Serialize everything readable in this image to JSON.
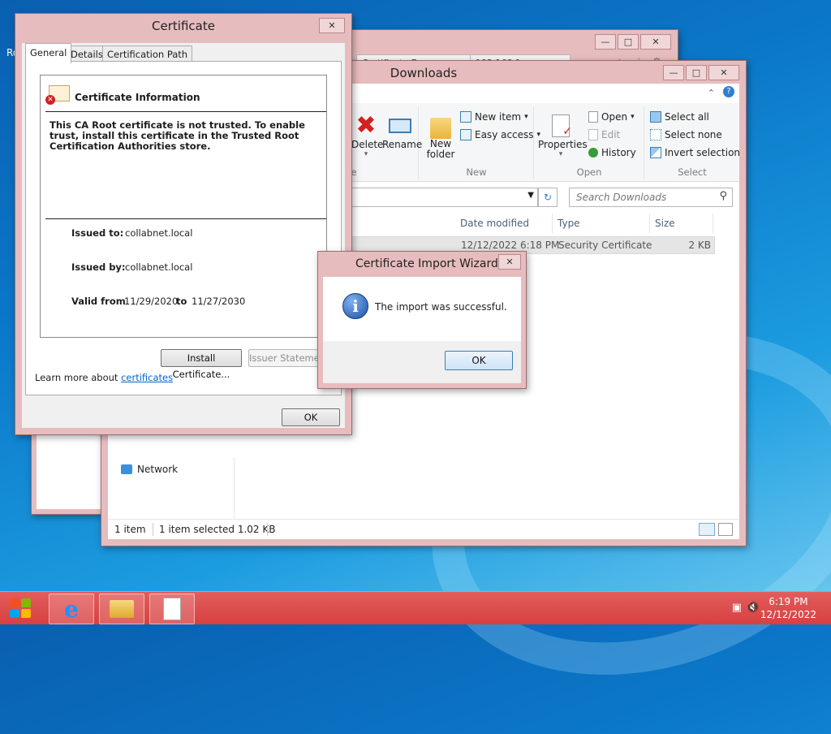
{
  "desktop": {
    "edge_text": "Ro"
  },
  "browser": {
    "tabs": [
      "Certificate Erro...",
      "192.168.1..."
    ]
  },
  "explorer": {
    "title": "Downloads",
    "ribbon": {
      "organize": {
        "delete": "Delete",
        "rename": "Rename",
        "label": "Organize"
      },
      "new": {
        "new_folder": "New folder",
        "new_item": "New item",
        "easy_access": "Easy access",
        "label": "New"
      },
      "open": {
        "properties": "Properties",
        "open": "Open",
        "edit": "Edit",
        "history": "History",
        "label": "Open"
      },
      "select": {
        "select_all": "Select all",
        "select_none": "Select none",
        "invert": "Invert selection",
        "label": "Select"
      }
    },
    "search_placeholder": "Search Downloads",
    "columns": [
      "Date modified",
      "Type",
      "Size"
    ],
    "file": {
      "date": "12/12/2022 6:18 PM",
      "type": "Security Certificate",
      "size": "2 KB"
    },
    "nav_network": "Network",
    "status": {
      "count": "1 item",
      "selected": "1 item selected  1.02 KB"
    }
  },
  "cert": {
    "title": "Certificate",
    "tabs": [
      "General",
      "Details",
      "Certification Path"
    ],
    "heading": "Certificate Information",
    "warning": "This CA Root certificate is not trusted. To enable trust, install this certificate in the Trusted Root Certification Authorities store.",
    "issued_to_label": "Issued to:",
    "issued_to": "collabnet.local",
    "issued_by_label": "Issued by:",
    "issued_by": "collabnet.local",
    "valid_from_label": "Valid from",
    "valid_from": "11/29/2020",
    "to_label": "to",
    "valid_to": "11/27/2030",
    "install_btn": "Install Certificate...",
    "issuer_btn": "Issuer Statement",
    "learn_prefix": "Learn more about ",
    "learn_link": "certificates",
    "ok": "OK"
  },
  "wizard": {
    "title": "Certificate Import Wizard",
    "message": "The import was successful.",
    "ok": "OK"
  },
  "taskbar": {
    "time": "6:19 PM",
    "date": "12/12/2022"
  },
  "colors": {
    "window_frame": "#e7bcbe",
    "taskbar": "#d84040",
    "link": "#0066cc",
    "accent": "#3c7fb1"
  }
}
